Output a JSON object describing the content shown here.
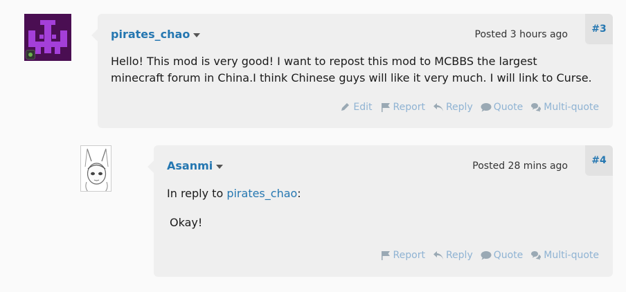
{
  "posts": [
    {
      "number": "#3",
      "username": "pirates_chao",
      "posted_label": "Posted",
      "posted_time": "3 hours ago",
      "body_line1": "Hello! This mod is very good! I want to repost this mod to MCBBS the largest",
      "body_line2": "minecraft forum in China.I think Chinese guys will like it very much. I will link to Curse.",
      "actions": {
        "edit": "Edit",
        "report": "Report",
        "reply": "Reply",
        "quote": "Quote",
        "multiquote": "Multi-quote"
      }
    },
    {
      "number": "#4",
      "username": "Asanmi",
      "posted_label": "Posted",
      "posted_time": "28 mins ago",
      "reply_prefix": "In reply to ",
      "reply_user": "pirates_chao",
      "reply_suffix": ":",
      "body": "Okay!",
      "actions": {
        "report": "Report",
        "reply": "Reply",
        "quote": "Quote",
        "multiquote": "Multi-quote"
      }
    }
  ],
  "colors": {
    "link": "#2577b1",
    "action": "#8fb3d3",
    "card": "#efefef",
    "avatar_bg": "#4a0e52",
    "avatar_fg": "#a43fd9"
  }
}
